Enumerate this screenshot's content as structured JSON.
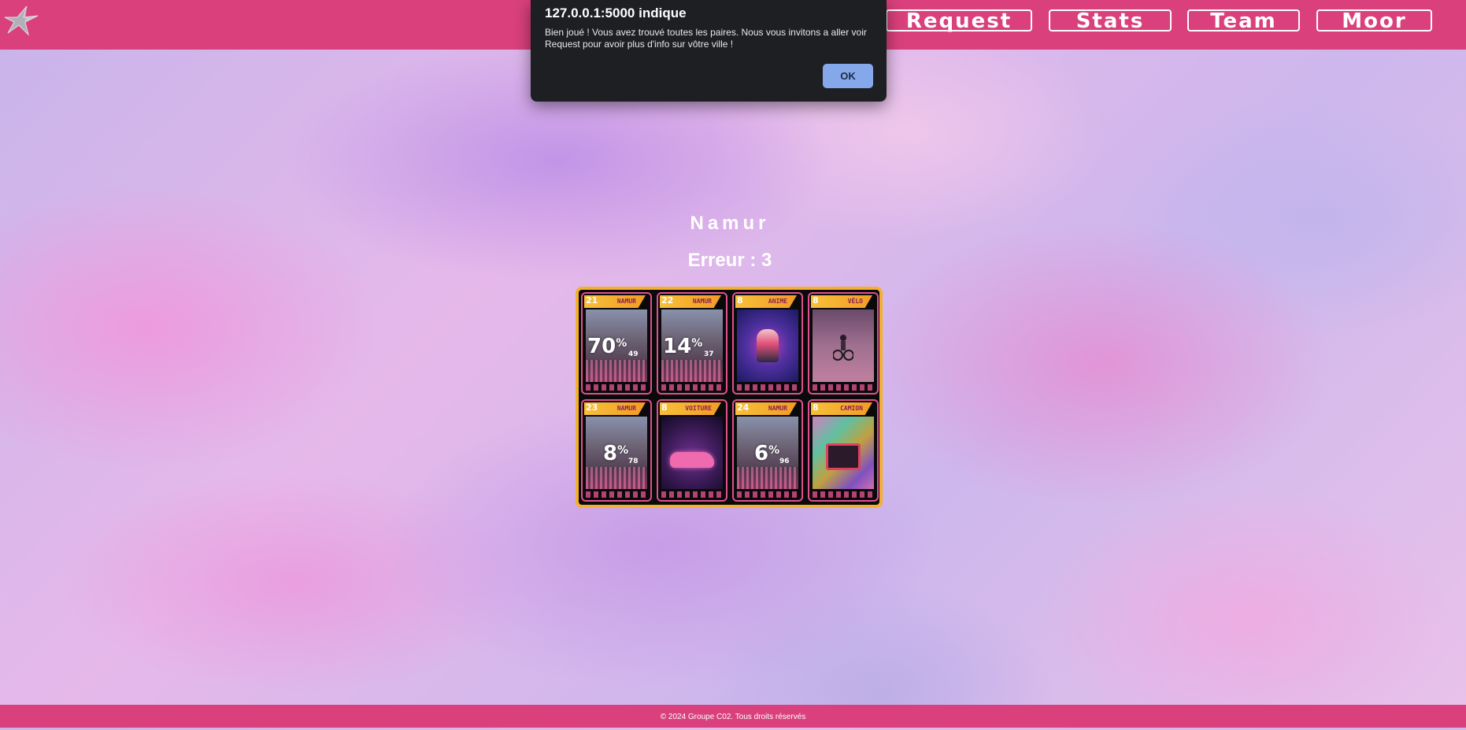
{
  "header": {
    "logo_icon": "star-logo-icon",
    "nav": [
      {
        "label": "Request"
      },
      {
        "label": "Stats"
      },
      {
        "label": "Team"
      },
      {
        "label": "Moor"
      }
    ]
  },
  "game": {
    "city": "Namur",
    "errors_label": "Erreur : 3"
  },
  "cards": [
    {
      "num": "21",
      "badge": "NAMUR",
      "type": "stat",
      "value": "70",
      "sign": "%",
      "sub": "49"
    },
    {
      "num": "22",
      "badge": "NAMUR",
      "type": "stat",
      "value": "14",
      "sign": "%",
      "sub": "37"
    },
    {
      "num": "8",
      "badge": "ANIME",
      "type": "image",
      "image": "anime-character"
    },
    {
      "num": "8",
      "badge": "VÉLO",
      "type": "image",
      "image": "bike-rider"
    },
    {
      "num": "23",
      "badge": "NAMUR",
      "type": "stat",
      "value": "8",
      "sign": "%",
      "sub": "78"
    },
    {
      "num": "8",
      "badge": "VOITURE",
      "type": "image",
      "image": "pink-car"
    },
    {
      "num": "24",
      "badge": "NAMUR",
      "type": "stat",
      "value": "6",
      "sign": "%",
      "sub": "96"
    },
    {
      "num": "8",
      "badge": "CAMION",
      "type": "image",
      "image": "holo-truck"
    }
  ],
  "alert": {
    "title": "127.0.0.1:5000 indique",
    "message": "Bien joué ! Vous avez trouvé toutes les paires. Nous vous invitons a aller voir Request pour avoir plus d'info sur vôtre ville !",
    "ok_label": "OK"
  },
  "footer": {
    "text": "© 2024 Groupe C02. Tous droits réservés"
  },
  "colors": {
    "header": "#d9407c",
    "board_border": "#f3b02f",
    "card_accent": "#e05090",
    "ok_button": "#85a8ea",
    "dialog_bg": "#1d1f23"
  }
}
